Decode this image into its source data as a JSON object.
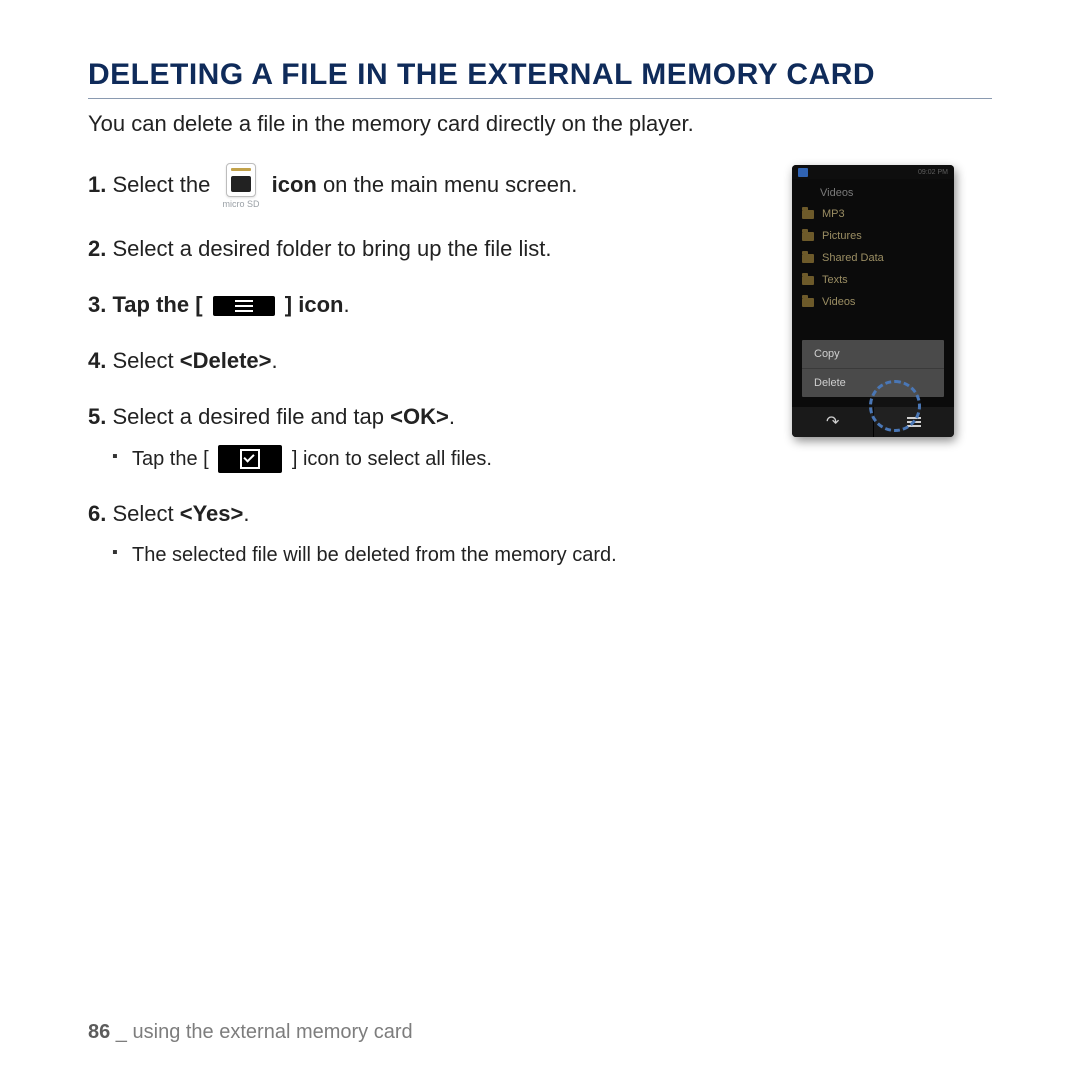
{
  "title": "DELETING A FILE IN THE EXTERNAL MEMORY CARD",
  "intro": "You can delete a file in the memory card directly on the player.",
  "steps": {
    "s1": {
      "num": "1.",
      "a": "Select the",
      "icon_label": "micro SD",
      "b_bold": "icon",
      "b_rest": " on the main menu screen."
    },
    "s2": {
      "num": "2.",
      "text": "Select a desired folder to bring up the file list."
    },
    "s3": {
      "num": "3.",
      "a": "Tap the ",
      "bracket_open": "[",
      "bracket_close": "]",
      "b": " icon",
      "c": "."
    },
    "s4": {
      "num": "4.",
      "a": "Select ",
      "b": "<Delete>",
      "c": "."
    },
    "s5": {
      "num": "5.",
      "a": "Select a desired file and tap ",
      "b": "<OK>",
      "c": ".",
      "sub": {
        "a": "Tap the ",
        "bracket_open": "[",
        "bracket_close": "]",
        "b": " icon to select all files."
      }
    },
    "s6": {
      "num": "6.",
      "a": "Select ",
      "b": "<Yes>",
      "c": ".",
      "sub": "The selected file will be deleted from the memory card."
    }
  },
  "device": {
    "time": "09:02 PM",
    "heading": "Videos",
    "folders": [
      "MP3",
      "Pictures",
      "Shared Data",
      "Texts",
      "Videos"
    ],
    "popup": [
      "Copy",
      "Delete"
    ]
  },
  "footer": {
    "page": "86",
    "sep": " _ ",
    "section": "using the external memory card"
  }
}
